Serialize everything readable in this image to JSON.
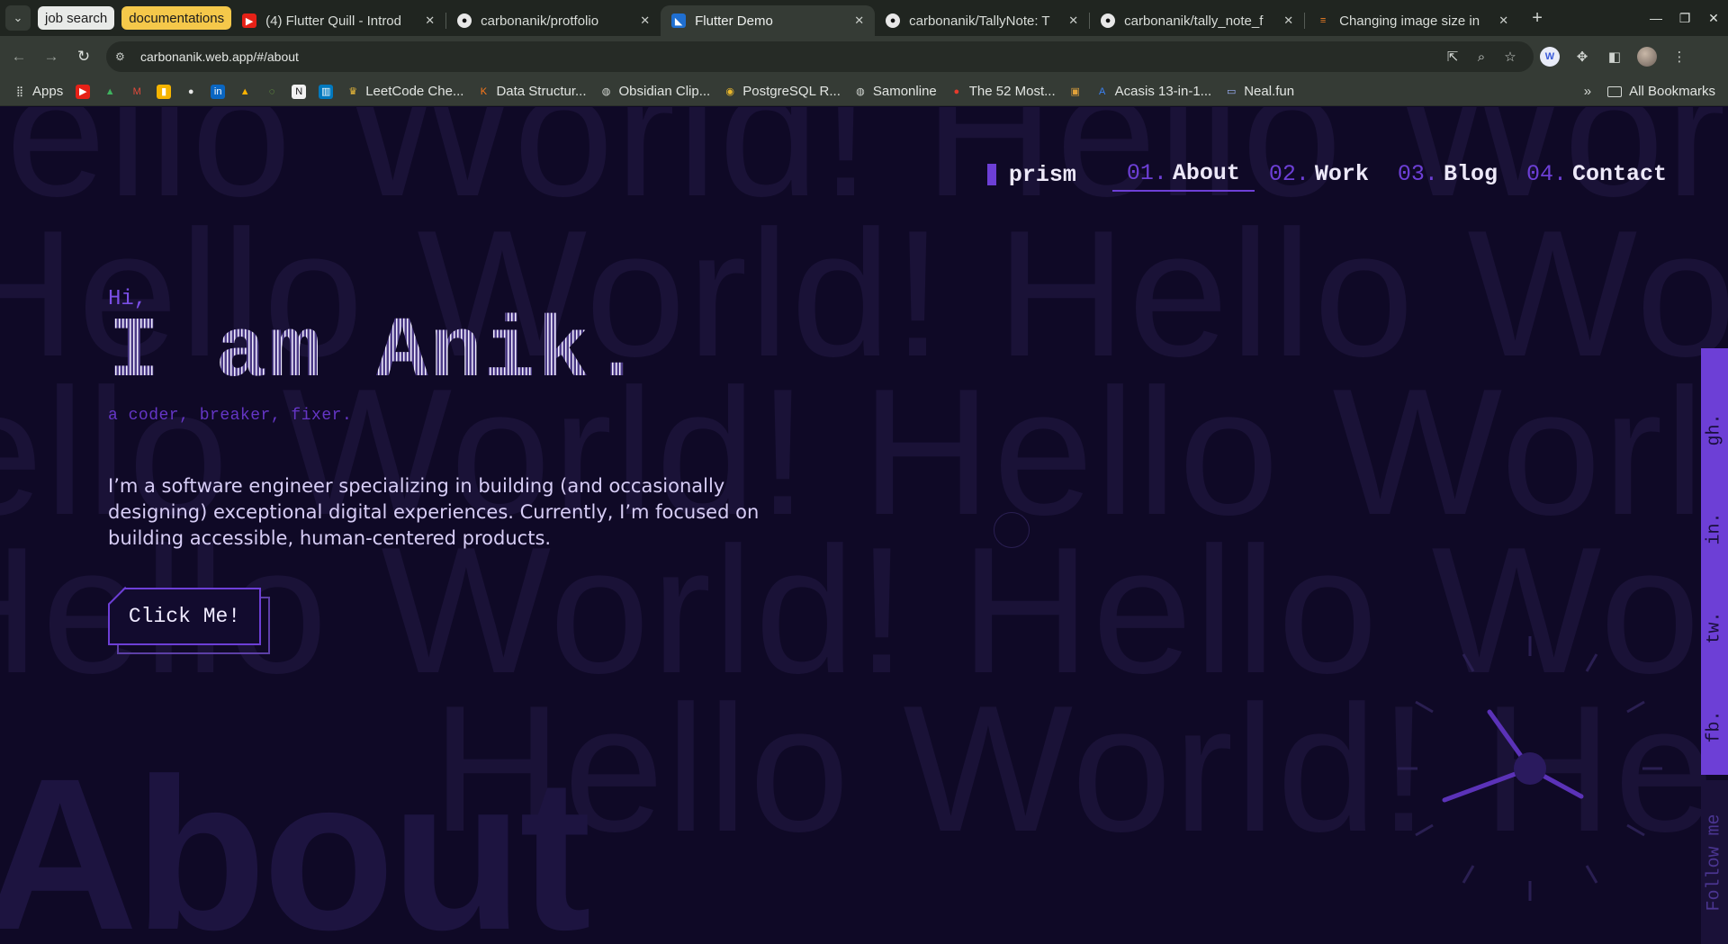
{
  "browser": {
    "tab_groups": [
      {
        "label": "job search"
      },
      {
        "label": "documentations"
      }
    ],
    "tabs": [
      {
        "title": "(4) Flutter Quill - Introd",
        "favicon": "youtube-icon"
      },
      {
        "title": "carbonanik/protfolio",
        "favicon": "github-icon"
      },
      {
        "title": "Flutter Demo",
        "favicon": "flutter-icon",
        "active": true
      },
      {
        "title": "carbonanik/TallyNote: T",
        "favicon": "github-icon"
      },
      {
        "title": "carbonanik/tally_note_f",
        "favicon": "github-icon"
      },
      {
        "title": "Changing image size in",
        "favicon": "stackoverflow-icon"
      }
    ],
    "url": "carbonanik.web.app/#/about",
    "bookmarks": [
      {
        "label": "Apps",
        "icon": "apps-grid-icon"
      },
      {
        "label": "",
        "icon": "youtube-icon"
      },
      {
        "label": "",
        "icon": "drive-icon"
      },
      {
        "label": "",
        "icon": "gmail-icon"
      },
      {
        "label": "",
        "icon": "keep-icon"
      },
      {
        "label": "",
        "icon": "github-icon"
      },
      {
        "label": "",
        "icon": "linkedin-icon"
      },
      {
        "label": "",
        "icon": "firebase-icon"
      },
      {
        "label": "",
        "icon": "leaf-icon"
      },
      {
        "label": "",
        "icon": "notion-icon"
      },
      {
        "label": "",
        "icon": "trello-icon"
      },
      {
        "label": "LeetCode Che...",
        "icon": "crown-icon"
      },
      {
        "label": "Data Structur...",
        "icon": "k-icon"
      },
      {
        "label": "Obsidian Clip...",
        "icon": "globe-icon"
      },
      {
        "label": "PostgreSQL R...",
        "icon": "chrome-icon"
      },
      {
        "label": "Samonline",
        "icon": "globe-icon"
      },
      {
        "label": "The 52 Most...",
        "icon": "tomato-icon"
      },
      {
        "label": "",
        "icon": "box-icon"
      },
      {
        "label": "Acasis 13-in-1...",
        "icon": "a-icon"
      },
      {
        "label": "Neal.fun",
        "icon": "laptop-icon"
      }
    ],
    "all_bookmarks": "All Bookmarks"
  },
  "site": {
    "brand": "prism",
    "nav": [
      {
        "num": "01.",
        "label": "About",
        "active": true
      },
      {
        "num": "02.",
        "label": "Work"
      },
      {
        "num": "03.",
        "label": "Blog"
      },
      {
        "num": "04.",
        "label": "Contact"
      }
    ],
    "background_text": "Hello World! Hello World! Hello World!",
    "background_heading": "About",
    "greeting": "Hi,",
    "name": "I am Anik.",
    "tagline": "a coder, breaker, fixer.",
    "bio": "I’m a software engineer specializing in building (and occasionally designing) exceptional digital experiences. Currently, I’m focused on building accessible, human-centered products.",
    "cta": "Click Me!",
    "social": [
      {
        "label": "gh."
      },
      {
        "label": "in."
      },
      {
        "label": "tw."
      },
      {
        "label": "fb."
      }
    ],
    "follow": "Follow me"
  },
  "colors": {
    "background": "#0f0926",
    "accent": "#6d3fd6",
    "text": "#ece8f8",
    "muted": "#d7cdf6"
  }
}
